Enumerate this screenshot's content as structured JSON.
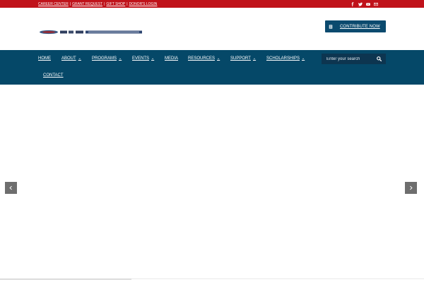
{
  "topbar": {
    "links": [
      "CAREER CENTER",
      "GRANT REQUEST",
      "GIFT SHOP",
      "DONOR'S LOGIN"
    ],
    "separator": "|",
    "social_icons": [
      "facebook-icon",
      "twitter-icon",
      "youtube-icon",
      "email-icon"
    ],
    "bg_color": "#c0121a"
  },
  "header": {
    "contribute_label": "CONTRIBUTE NOW",
    "contribute_icon": "document-icon",
    "button_color": "#0b4a6e"
  },
  "nav": {
    "bg_color": "#054868",
    "items": [
      {
        "label": "HOME",
        "dropdown": false
      },
      {
        "label": "ABOUT",
        "dropdown": true
      },
      {
        "label": "PROGRAMS",
        "dropdown": true
      },
      {
        "label": "EVENTS",
        "dropdown": true
      },
      {
        "label": "MEDIA",
        "dropdown": false
      },
      {
        "label": "RESOURCES",
        "dropdown": true
      },
      {
        "label": "SUPPORT",
        "dropdown": true
      },
      {
        "label": "SCHOLARSHIPS",
        "dropdown": true
      },
      {
        "label": "CONTACT",
        "dropdown": false
      }
    ],
    "chevron": "⌄",
    "search_placeholder": "Enter your search",
    "search_icon": "search-icon"
  },
  "slider": {
    "prev_icon": "chevron-left-icon",
    "next_icon": "chevron-right-icon"
  }
}
